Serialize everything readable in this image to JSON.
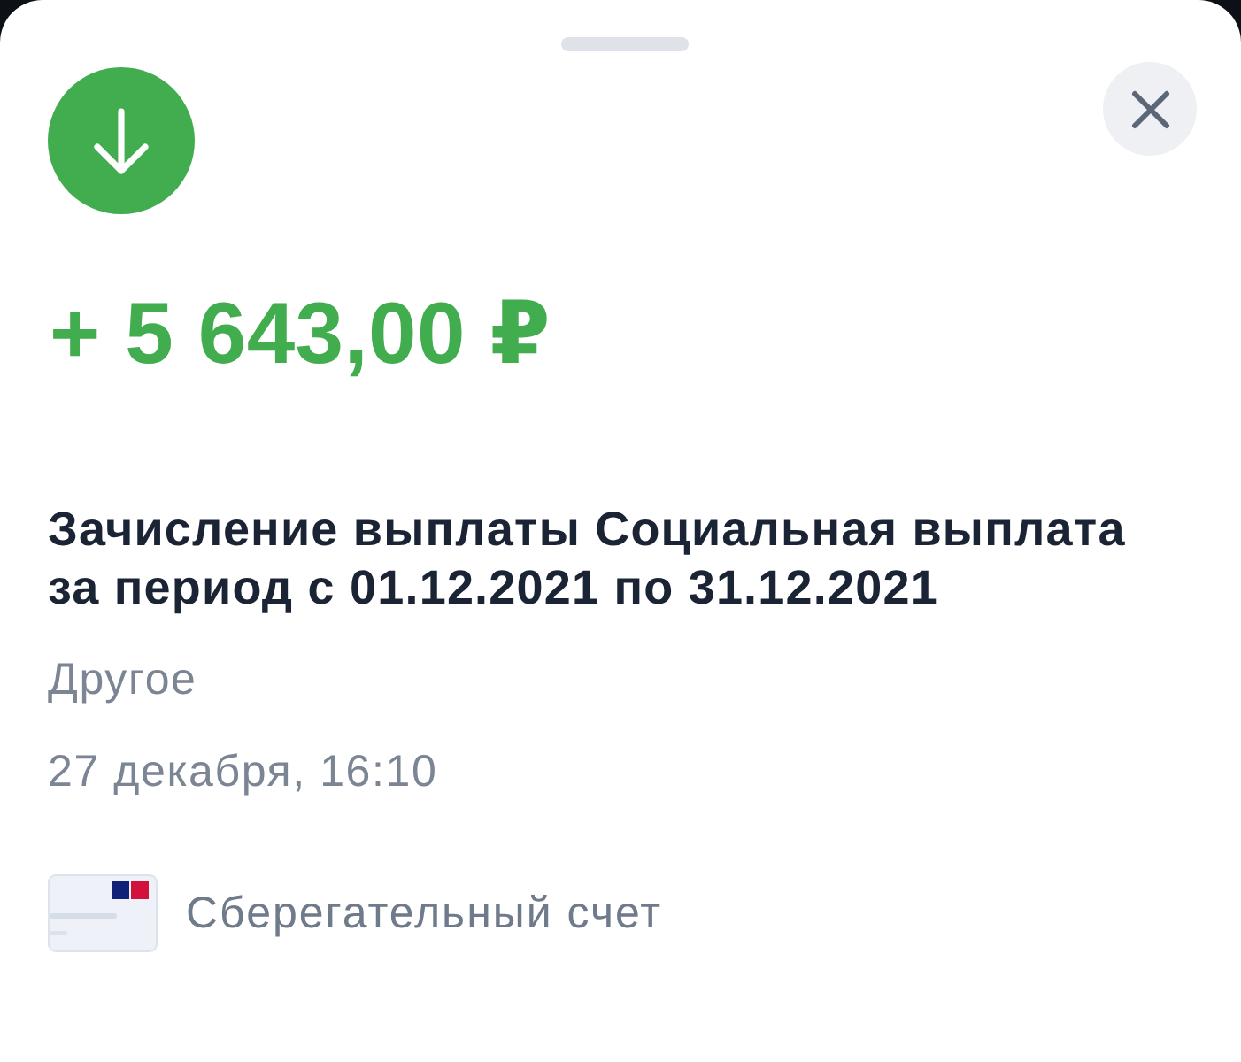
{
  "transaction": {
    "kind": "income",
    "amount": "+ 5 643,00 ₽",
    "title": "Зачисление выплаты Социальная выплата за период с 01.12.2021 по 31.12.2021",
    "category": "Другое",
    "datetime": "27 декабря, 16:10"
  },
  "account": {
    "name": "Сберегательный счет"
  }
}
